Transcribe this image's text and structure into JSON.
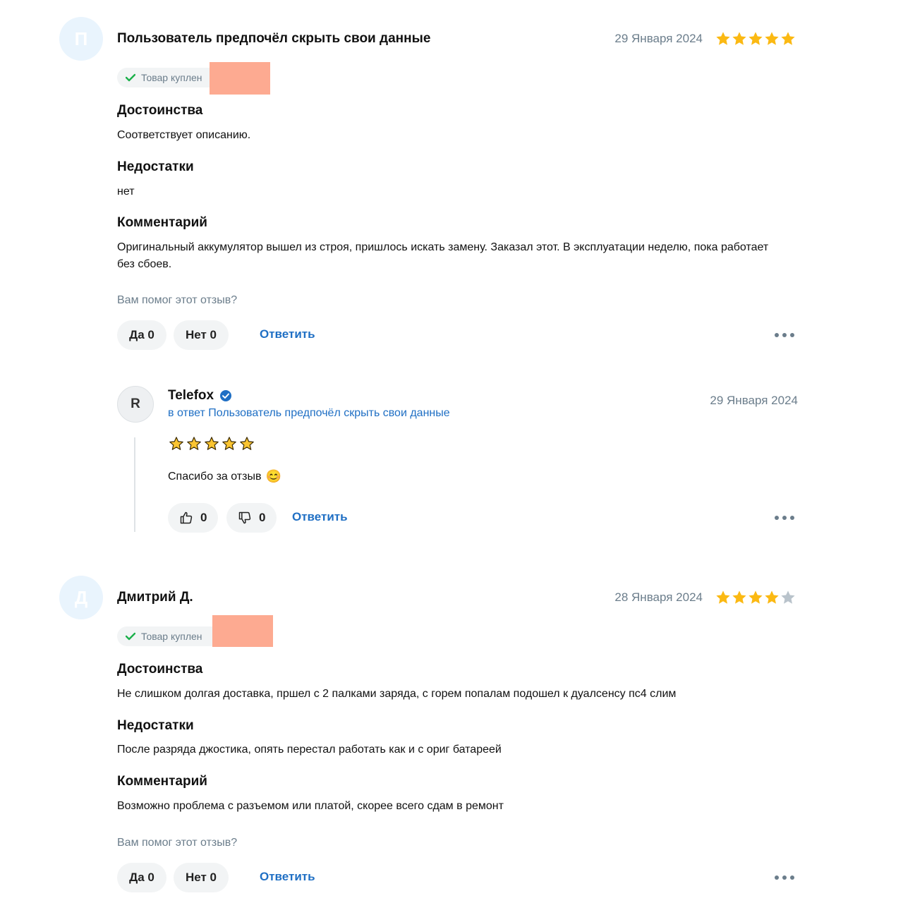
{
  "reviews": [
    {
      "avatar_letter": "П",
      "author": "Пользователь предпочёл скрыть свои данные",
      "date": "29 Января 2024",
      "rating": 5,
      "bought_label": "Товар куплен",
      "pros_title": "Достоинства",
      "pros_text": "Соответствует описанию.",
      "cons_title": "Недостатки",
      "cons_text": "нет",
      "comment_title": "Комментарий",
      "comment_text": "Оригинальный аккумулятор вышел из строя, пришлось искать замену. Заказал этот. В эксплуатации неделю, пока работает без сбоев.",
      "helpful_question": "Вам помог этот отзыв?",
      "yes_label": "Да 0",
      "no_label": "Нет 0",
      "reply_label": "Ответить"
    },
    {
      "avatar_letter": "Д",
      "author": "Дмитрий Д.",
      "date": "28 Января 2024",
      "rating": 4,
      "bought_label": "Товар куплен",
      "pros_title": "Достоинства",
      "pros_text": "Не слишком долгая доставка, пршел с 2 палками заряда, с горем попалам подошел к дуалсенсу пс4 слим",
      "cons_title": "Недостатки",
      "cons_text": "После разряда джостика, опять перестал работать как и с ориг батареей",
      "comment_title": "Комментарий",
      "comment_text": "Возможно проблема с разъемом или платой, скорее всего сдам в ремонт",
      "helpful_question": "Вам помог этот отзыв?",
      "yes_label": "Да 0",
      "no_label": "Нет 0",
      "reply_label": "Ответить"
    }
  ],
  "seller_reply": {
    "avatar_letter": "R",
    "name": "Telefox",
    "verified_icon": "verified-check-icon",
    "reply_to": "в ответ Пользователь предпочёл скрыть свои данные",
    "date": "29 Января 2024",
    "rating": 5,
    "text": "Спасибо за отзыв",
    "emoji": "😊",
    "likes": "0",
    "dislikes": "0",
    "reply_label": "Ответить"
  },
  "colors": {
    "star_filled": "#fbb913",
    "star_empty": "#b9c3cb",
    "link": "#1f6fc4",
    "muted": "#6b7d8b",
    "redaction": "#fdaa91",
    "check": "#1bb04a"
  },
  "icons": {
    "check": "check-icon",
    "star": "star-icon",
    "thumb_up": "thumbs-up-icon",
    "thumb_down": "thumbs-down-icon",
    "more": "more-dots-icon"
  }
}
